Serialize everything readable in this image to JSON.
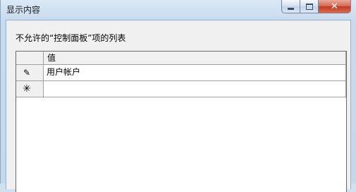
{
  "window": {
    "title": "显示内容",
    "minimize_glyph": "",
    "close_glyph": "✕"
  },
  "dialog": {
    "caption": "不允许的“控制面板”项的列表"
  },
  "grid": {
    "column_header": "值",
    "rows": [
      {
        "indicator": "✎",
        "value": "用户帐户"
      },
      {
        "indicator": "✳",
        "value": ""
      }
    ]
  }
}
